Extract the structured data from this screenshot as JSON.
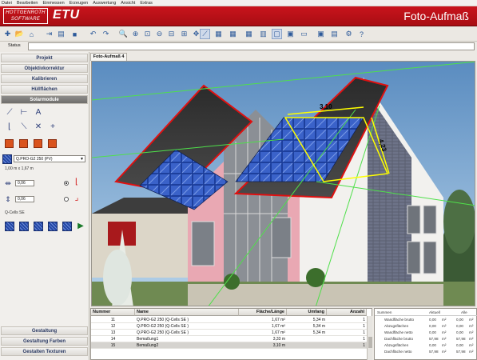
{
  "menu": [
    "Datei",
    "Bearbeiten",
    "Einmessen",
    "Erzeugen",
    "Auswertung",
    "Ansicht",
    "Extras"
  ],
  "banner": {
    "logo_line1": "HOTTGENROTH",
    "logo_line2": "SOFTWARE",
    "brand": "ETU",
    "title": "Foto-Aufmaß"
  },
  "status": {
    "label": "Status",
    "value": ""
  },
  "left_panel": {
    "sections": [
      "Projekt",
      "Objektivkorrektur",
      "Kalibrieren",
      "Hüllflächen",
      "Solarmodule"
    ],
    "module_select": "Q.PRO-G2 250 (PV)",
    "module_dims": "1,00 m x 1,67 m",
    "spacing1": "0,06",
    "spacing2": "0,06",
    "brand_label": "Q-Cells SE",
    "bottom_sections": [
      "Gestaltung",
      "Gestaltung Farben",
      "Gestalten Texturen"
    ]
  },
  "document_tab": "Foto-Aufmaß 4",
  "measure_labels": {
    "width": "3,10",
    "height": "4,23"
  },
  "table": {
    "headers": [
      "Nummer",
      "Name",
      "Fläche/Länge",
      "Umfang",
      "Anzahl"
    ],
    "rows": [
      {
        "nr": "11",
        "name": "Q.PRO-G2 250 (Q-Cells SE )",
        "area": "1,67 m²",
        "perim": "5,34 m",
        "count": "1"
      },
      {
        "nr": "12",
        "name": "Q.PRO-G2 250 (Q-Cells SE )",
        "area": "1,67 m²",
        "perim": "5,34 m",
        "count": "1"
      },
      {
        "nr": "13",
        "name": "Q.PRO-G2 250 (Q-Cells SE )",
        "area": "1,67 m²",
        "perim": "5,34 m",
        "count": "1"
      },
      {
        "nr": "14",
        "name": "Bemaßung1",
        "area": "3,33 m",
        "perim": "",
        "count": "1"
      },
      {
        "nr": "15",
        "name": "Bemaßung2",
        "area": "3,10 m",
        "perim": "",
        "count": "1"
      }
    ]
  },
  "summary": {
    "headers": [
      "Summen",
      "Aktuell",
      "Alle"
    ],
    "rows": [
      {
        "label": "Wandfläche brutto",
        "cur": "0,00",
        "cur_unit": "m²",
        "all": "0,00",
        "all_unit": "m²"
      },
      {
        "label": "Abzugsflächen",
        "cur": "0,00",
        "cur_unit": "m²",
        "all": "0,00",
        "all_unit": "m²"
      },
      {
        "label": "Wandfläche netto",
        "cur": "0,00",
        "cur_unit": "m²",
        "all": "0,00",
        "all_unit": "m²"
      },
      {
        "label": "Dachfläche brutto",
        "cur": "57,98",
        "cur_unit": "m²",
        "all": "57,98",
        "all_unit": "m²"
      },
      {
        "label": "Abzugsflächen",
        "cur": "0,00",
        "cur_unit": "m²",
        "all": "0,00",
        "all_unit": "m²"
      },
      {
        "label": "Dachfläche netto",
        "cur": "57,98",
        "cur_unit": "m²",
        "all": "57,98",
        "all_unit": "m²"
      }
    ]
  },
  "colors": {
    "banner_red": "#c9141c",
    "selection_yellow": "#ffff00",
    "roof_red_outline": "#e01010",
    "pv_blue": "#2447a6"
  }
}
